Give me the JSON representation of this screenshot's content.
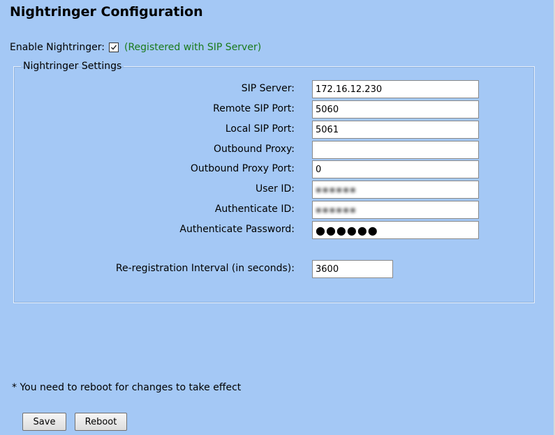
{
  "title": "Nightringer Configuration",
  "enable": {
    "label": "Enable Nightringer:",
    "checked": true,
    "status": "(Registered with SIP Server)"
  },
  "settings": {
    "legend": "Nightringer Settings",
    "fields": {
      "sip_server": {
        "label": "SIP Server:",
        "value": "172.16.12.230"
      },
      "remote_sip_port": {
        "label": "Remote SIP Port:",
        "value": "5060"
      },
      "local_sip_port": {
        "label": "Local SIP Port:",
        "value": "5061"
      },
      "outbound_proxy": {
        "label": "Outbound Proxy:",
        "value": ""
      },
      "outbound_proxy_port": {
        "label": "Outbound Proxy Port:",
        "value": "0"
      },
      "user_id": {
        "label": "User ID:",
        "value": ""
      },
      "authenticate_id": {
        "label": "Authenticate ID:",
        "value": ""
      },
      "authenticate_password": {
        "label": "Authenticate Password:",
        "value": "●●●●●●"
      },
      "reregistration_interval": {
        "label": "Re-registration Interval (in seconds):",
        "value": "3600"
      }
    }
  },
  "notice": "* You need to reboot for changes to take effect",
  "buttons": {
    "save": "Save",
    "reboot": "Reboot"
  }
}
